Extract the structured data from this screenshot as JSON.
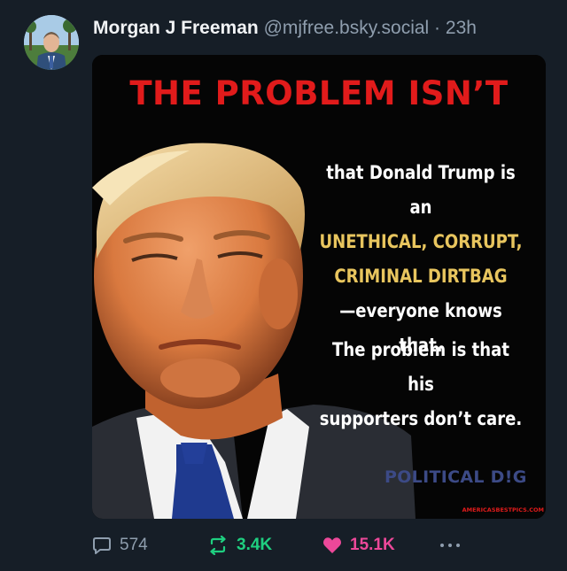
{
  "post": {
    "author": {
      "display_name": "Morgan J Freeman",
      "handle": "@mjfree.bsky.social",
      "separator": " · ",
      "time": "23h"
    },
    "image": {
      "headline": "THE PROBLEM ISN’T",
      "block1": {
        "line1": "that Donald Trump is an",
        "line2": "UNETHICAL, CORRUPT,",
        "line3": "CRIMINAL DIRTBAG",
        "line4": "—everyone knows that."
      },
      "block2": {
        "line1": "The problem is that his",
        "line2": "supporters don’t care."
      },
      "watermark": "POLITICAL D!G",
      "site_credit": "AMERICASBESTPICS.COM"
    },
    "actions": {
      "reply_count": "574",
      "repost_count": "3.4K",
      "like_count": "15.1K"
    }
  },
  "icons": {
    "reply": "speech-bubble-icon",
    "repost": "repost-arrows-icon",
    "like": "heart-icon",
    "more": "ellipsis-icon"
  },
  "colors": {
    "background": "#161e27",
    "repost_active": "#1fcf80",
    "like_active": "#ec4899",
    "muted_text": "#8f9eae",
    "headline_red": "#e11b1b",
    "highlight_yellow": "#e8c55e"
  }
}
